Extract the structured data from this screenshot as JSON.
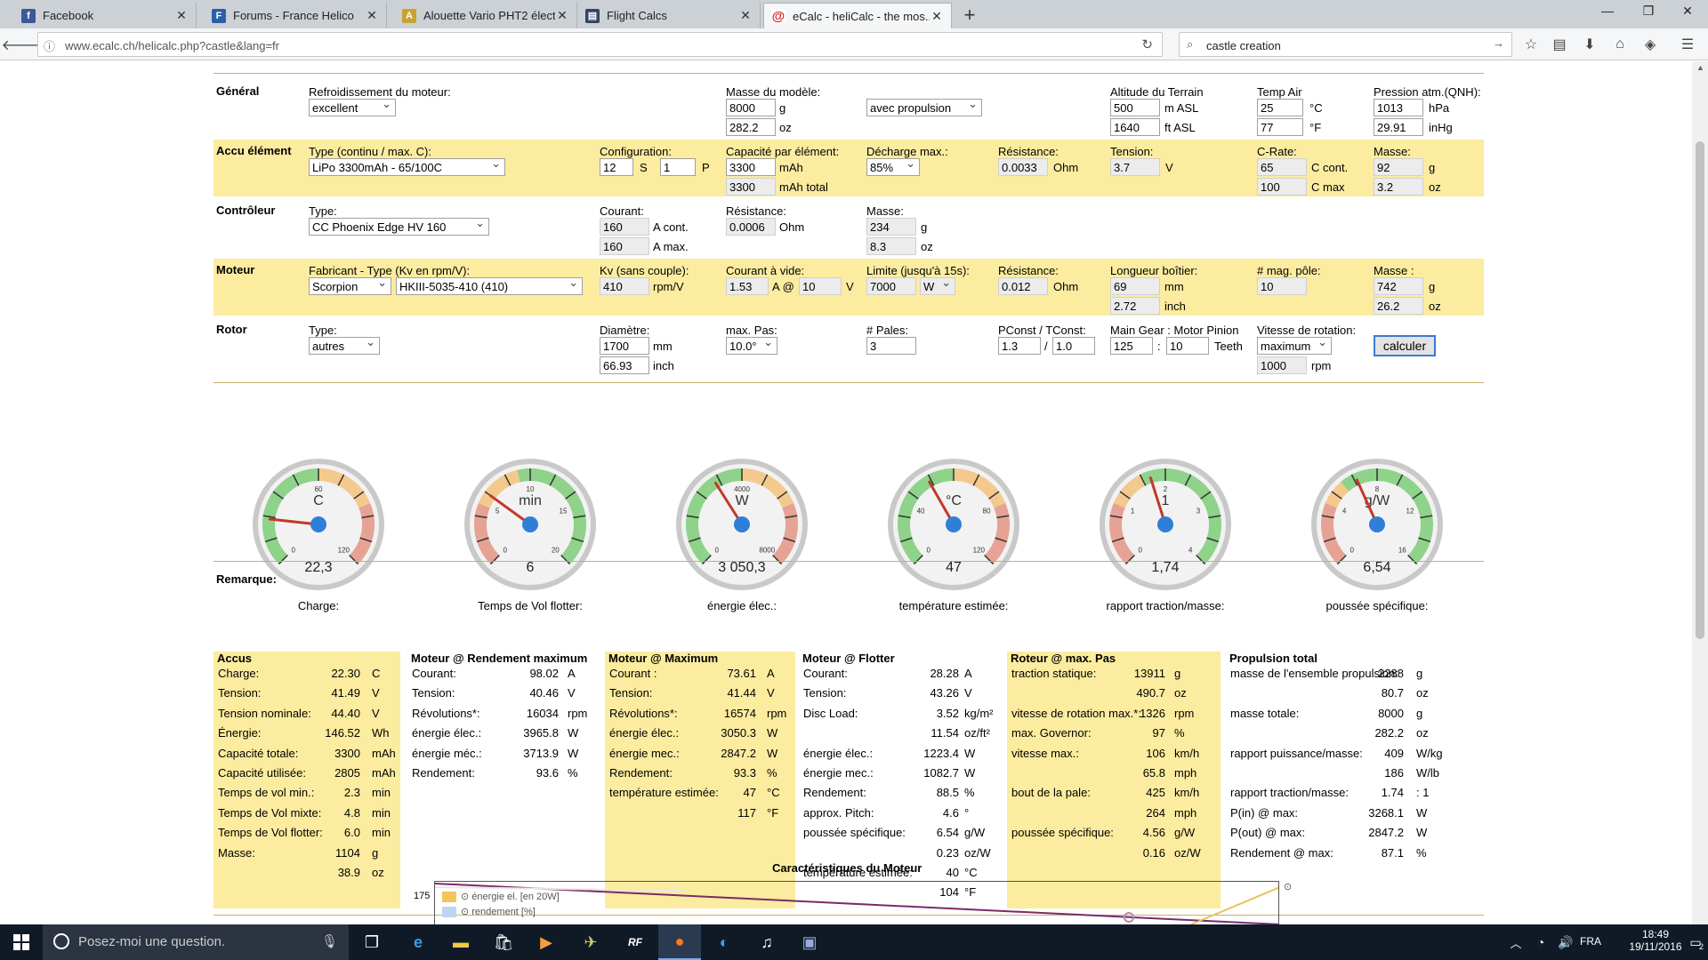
{
  "browser": {
    "tabs": [
      {
        "title": "Facebook",
        "icon": "facebook-icon",
        "color": "#3b5998",
        "glyph": "f"
      },
      {
        "title": "Forums - France Helico",
        "icon": "forum-icon",
        "color": "#2d5fa8",
        "glyph": "F"
      },
      {
        "title": "Alouette Vario PHT2 électr...",
        "icon": "alouette-icon",
        "color": "#c9a22f",
        "glyph": "A"
      },
      {
        "title": "Flight Calcs",
        "icon": "document-icon",
        "color": "#334466",
        "glyph": "▤"
      },
      {
        "title": "eCalc - heliCalc - the mos...",
        "icon": "ecalc-icon",
        "color": "#d22",
        "glyph": "@"
      }
    ],
    "url": "www.ecalc.ch/helicalc.php?castle&lang=fr",
    "search": "castle creation"
  },
  "general": {
    "section": "Général",
    "cooling_label": "Refroidissement du moteur:",
    "cooling_value": "excellent",
    "mass_label": "Masse du modèle:",
    "mass_g": "8000",
    "mass_g_unit": "g",
    "mass_oz": "282.2",
    "mass_oz_unit": "oz",
    "propulsion_value": "avec propulsion",
    "alt_label": "Altitude du Terrain",
    "alt_m": "500",
    "alt_m_unit": "m ASL",
    "alt_ft": "1640",
    "alt_ft_unit": "ft ASL",
    "temp_label": "Temp Air",
    "temp_c": "25",
    "temp_c_unit": "°C",
    "temp_f": "77",
    "temp_f_unit": "°F",
    "pres_label": "Pression atm.(QNH):",
    "pres_hpa": "1013",
    "pres_hpa_unit": "hPa",
    "pres_inhg": "29.91",
    "pres_inhg_unit": "inHg"
  },
  "accu": {
    "section": "Accu élément",
    "type_label": "Type (continu / max. C):",
    "type_value": "LiPo 3300mAh - 65/100C",
    "config_label": "Configuration:",
    "s_value": "12",
    "s_unit": "S",
    "p_value": "1",
    "p_unit": "P",
    "cap_label": "Capacité par élément:",
    "cap_value": "3300",
    "cap_unit": "mAh",
    "cap_total": "3300",
    "cap_total_unit": "mAh total",
    "dis_label": "Décharge max.:",
    "dis_value": "85%",
    "res_label": "Résistance:",
    "res_value": "0.0033",
    "res_unit": "Ohm",
    "volt_label": "Tension:",
    "volt_value": "3.7",
    "volt_unit": "V",
    "crate_label": "C-Rate:",
    "c_cont": "65",
    "c_cont_unit": "C cont.",
    "c_max": "100",
    "c_max_unit": "C max",
    "mass_label": "Masse:",
    "mass_g": "92",
    "mass_g_unit": "g",
    "mass_oz": "3.2",
    "mass_oz_unit": "oz"
  },
  "esc": {
    "section": "Contrôleur",
    "type_label": "Type:",
    "type_value": "CC Phoenix Edge HV 160",
    "cur_label": "Courant:",
    "cur_cont": "160",
    "cur_cont_unit": "A cont.",
    "cur_max": "160",
    "cur_max_unit": "A max.",
    "res_label": "Résistance:",
    "res_value": "0.0006",
    "res_unit": "Ohm",
    "mass_label": "Masse:",
    "mass_g": "234",
    "mass_g_unit": "g",
    "mass_oz": "8.3",
    "mass_oz_unit": "oz"
  },
  "motor": {
    "section": "Moteur",
    "mfr_label": "Fabricant - Type (Kv en rpm/V):",
    "mfr_value": "Scorpion",
    "type_value": "HKIII-5035-410 (410)",
    "kv_label": "Kv (sans couple):",
    "kv_value": "410",
    "kv_unit": "rpm/V",
    "noload_label": "Courant à vide:",
    "noload_a": "1.53",
    "noload_a_unit": "A @",
    "noload_v": "10",
    "noload_v_unit": "V",
    "limit_label": "Limite (jusqu'à 15s):",
    "limit_value": "7000",
    "limit_unit": "W",
    "res_label": "Résistance:",
    "res_value": "0.012",
    "res_unit": "Ohm",
    "len_label": "Longueur boîtier:",
    "len_mm": "69",
    "len_mm_unit": "mm",
    "len_in": "2.72",
    "len_in_unit": "inch",
    "poles_label": "# mag. pôle:",
    "poles_value": "10",
    "mass_label": "Masse :",
    "mass_g": "742",
    "mass_g_unit": "g",
    "mass_oz": "26.2",
    "mass_oz_unit": "oz"
  },
  "rotor": {
    "section": "Rotor",
    "type_label": "Type:",
    "type_value": "autres",
    "dia_label": "Diamètre:",
    "dia_mm": "1700",
    "dia_mm_unit": "mm",
    "dia_in": "66.93",
    "dia_in_unit": "inch",
    "pitch_label": "max. Pas:",
    "pitch_value": "10.0°",
    "blades_label": "# Pales:",
    "blades_value": "3",
    "pconst_label": "PConst / TConst:",
    "pconst": "1.3",
    "slash": "/",
    "tconst": "1.0",
    "gear_label": "Main Gear : Motor Pinion",
    "gear_main": "125",
    "colon": ":",
    "gear_pinion": "10",
    "gear_unit": "Teeth",
    "speed_label": "Vitesse de rotation:",
    "speed_mode": "maximum",
    "speed_value": "1000",
    "speed_unit": "rpm",
    "calc_button": "calculer"
  },
  "gauges": [
    {
      "unit": "C",
      "value": "22,3",
      "caption": "Charge:",
      "min": "0",
      "max": "120",
      "mid": "60",
      "fill": 0.19
    },
    {
      "unit": "min",
      "value": "6",
      "caption": "Temps de Vol flotter:",
      "min": "0",
      "max": "20",
      "mid": "10",
      "t1": "5",
      "t2": "15",
      "fill": 0.3
    },
    {
      "unit": "W",
      "value": "3 050,3",
      "caption": "énergie élec.:",
      "min": "0",
      "max": "8000",
      "mid": "4000",
      "fill": 0.38
    },
    {
      "unit": "°C",
      "value": "47",
      "caption": "température estimée:",
      "min": "0",
      "max": "120",
      "t1": "40",
      "t2": "80",
      "fill": 0.39
    },
    {
      "unit": "1",
      "value": "1,74",
      "caption": "rapport traction/masse:",
      "min": "0",
      "max": "4",
      "mid": "2",
      "t1": "1",
      "t2": "3",
      "fill": 0.435
    },
    {
      "unit": "g/W",
      "value": "6,54",
      "caption": "poussée spécifique:",
      "min": "0",
      "max": "16",
      "mid": "8",
      "t1": "4",
      "t2": "12",
      "fill": 0.41
    }
  ],
  "remark": "Remarque:",
  "results": {
    "accus": {
      "title": "Accus",
      "rows": [
        [
          "Charge:",
          "22.30",
          "C"
        ],
        [
          "Tension:",
          "41.49",
          "V"
        ],
        [
          "Tension nominale:",
          "44.40",
          "V"
        ],
        [
          "Énergie:",
          "146.52",
          "Wh"
        ],
        [
          "Capacité totale:",
          "3300",
          "mAh"
        ],
        [
          "Capacité utilisée:",
          "2805",
          "mAh"
        ],
        [
          "Temps de vol min.:",
          "2.3",
          "min"
        ],
        [
          "Temps de Vol mixte:",
          "4.8",
          "min"
        ],
        [
          "Temps de Vol flotter:",
          "6.0",
          "min"
        ],
        [
          "Masse:",
          "1104",
          "g"
        ],
        [
          "",
          "38.9",
          "oz"
        ]
      ]
    },
    "moteur_eff": {
      "title": "Moteur @ Rendement maximum",
      "rows": [
        [
          "Courant:",
          "98.02",
          "A"
        ],
        [
          "Tension:",
          "40.46",
          "V"
        ],
        [
          "Révolutions*:",
          "16034",
          "rpm"
        ],
        [
          "énergie élec.:",
          "3965.8",
          "W"
        ],
        [
          "énergie méc.:",
          "3713.9",
          "W"
        ],
        [
          "Rendement:",
          "93.6",
          "%"
        ]
      ]
    },
    "moteur_max": {
      "title": "Moteur @ Maximum",
      "rows": [
        [
          "Courant :",
          "73.61",
          "A"
        ],
        [
          "Tension:",
          "41.44",
          "V"
        ],
        [
          "Révolutions*:",
          "16574",
          "rpm"
        ],
        [
          "énergie élec.:",
          "3050.3",
          "W"
        ],
        [
          "énergie mec.:",
          "2847.2",
          "W"
        ],
        [
          "Rendement:",
          "93.3",
          "%"
        ],
        [
          "température estimée:",
          "47",
          "°C"
        ],
        [
          "",
          "117",
          "°F"
        ]
      ]
    },
    "moteur_hover": {
      "title": "Moteur @ Flotter",
      "rows": [
        [
          "Courant:",
          "28.28",
          "A"
        ],
        [
          "Tension:",
          "43.26",
          "V"
        ],
        [
          "Disc Load:",
          "3.52",
          "kg/m²"
        ],
        [
          "",
          "11.54",
          "oz/ft²"
        ],
        [
          "énergie élec.:",
          "1223.4",
          "W"
        ],
        [
          "énergie mec.:",
          "1082.7",
          "W"
        ],
        [
          "Rendement:",
          "88.5",
          "%"
        ],
        [
          "approx. Pitch:",
          "4.6",
          "°"
        ],
        [
          "poussée spécifique:",
          "6.54",
          "g/W"
        ],
        [
          "",
          "0.23",
          "oz/W"
        ],
        [
          "température estimée:",
          "40",
          "°C"
        ],
        [
          "",
          "104",
          "°F"
        ]
      ]
    },
    "rotor_max": {
      "title": "Roteur @ max. Pas",
      "rows": [
        [
          "traction statique:",
          "13911",
          "g"
        ],
        [
          "",
          "490.7",
          "oz"
        ],
        [
          "vitesse de rotation max.*:",
          "1326",
          "rpm"
        ],
        [
          "max. Governor:",
          "97",
          "%"
        ],
        [
          "vitesse max.:",
          "106",
          "km/h"
        ],
        [
          "",
          "65.8",
          "mph"
        ],
        [
          "bout de la pale:",
          "425",
          "km/h"
        ],
        [
          "",
          "264",
          "mph"
        ],
        [
          "poussée spécifique:",
          "4.56",
          "g/W"
        ],
        [
          "",
          "0.16",
          "oz/W"
        ]
      ]
    },
    "total": {
      "title": "Propulsion total",
      "rows": [
        [
          "masse de l'ensemble propulsion:",
          "2288",
          "g"
        ],
        [
          "",
          "80.7",
          "oz"
        ],
        [
          "masse totale:",
          "8000",
          "g"
        ],
        [
          "",
          "282.2",
          "oz"
        ],
        [
          "rapport puissance/masse:",
          "409",
          "W/kg"
        ],
        [
          "",
          "186",
          "W/lb"
        ],
        [
          "rapport traction/masse:",
          "1.74",
          ": 1"
        ],
        [
          "P(in) @ max:",
          "3268.1",
          "W"
        ],
        [
          "P(out) @ max:",
          "2847.2",
          "W"
        ],
        [
          "Rendement @ max:",
          "87.1",
          "%"
        ]
      ]
    }
  },
  "chart": {
    "title": "Caractéristiques du Moteur",
    "ytick": "175",
    "legend": [
      "⊙ énergie el. [en 20W]",
      "⊙ rendement [%]"
    ]
  },
  "taskbar": {
    "search_placeholder": "Posez-moi une question.",
    "lang": "FRA",
    "time": "18:49",
    "date": "19/11/2016",
    "notif_count": "2"
  }
}
